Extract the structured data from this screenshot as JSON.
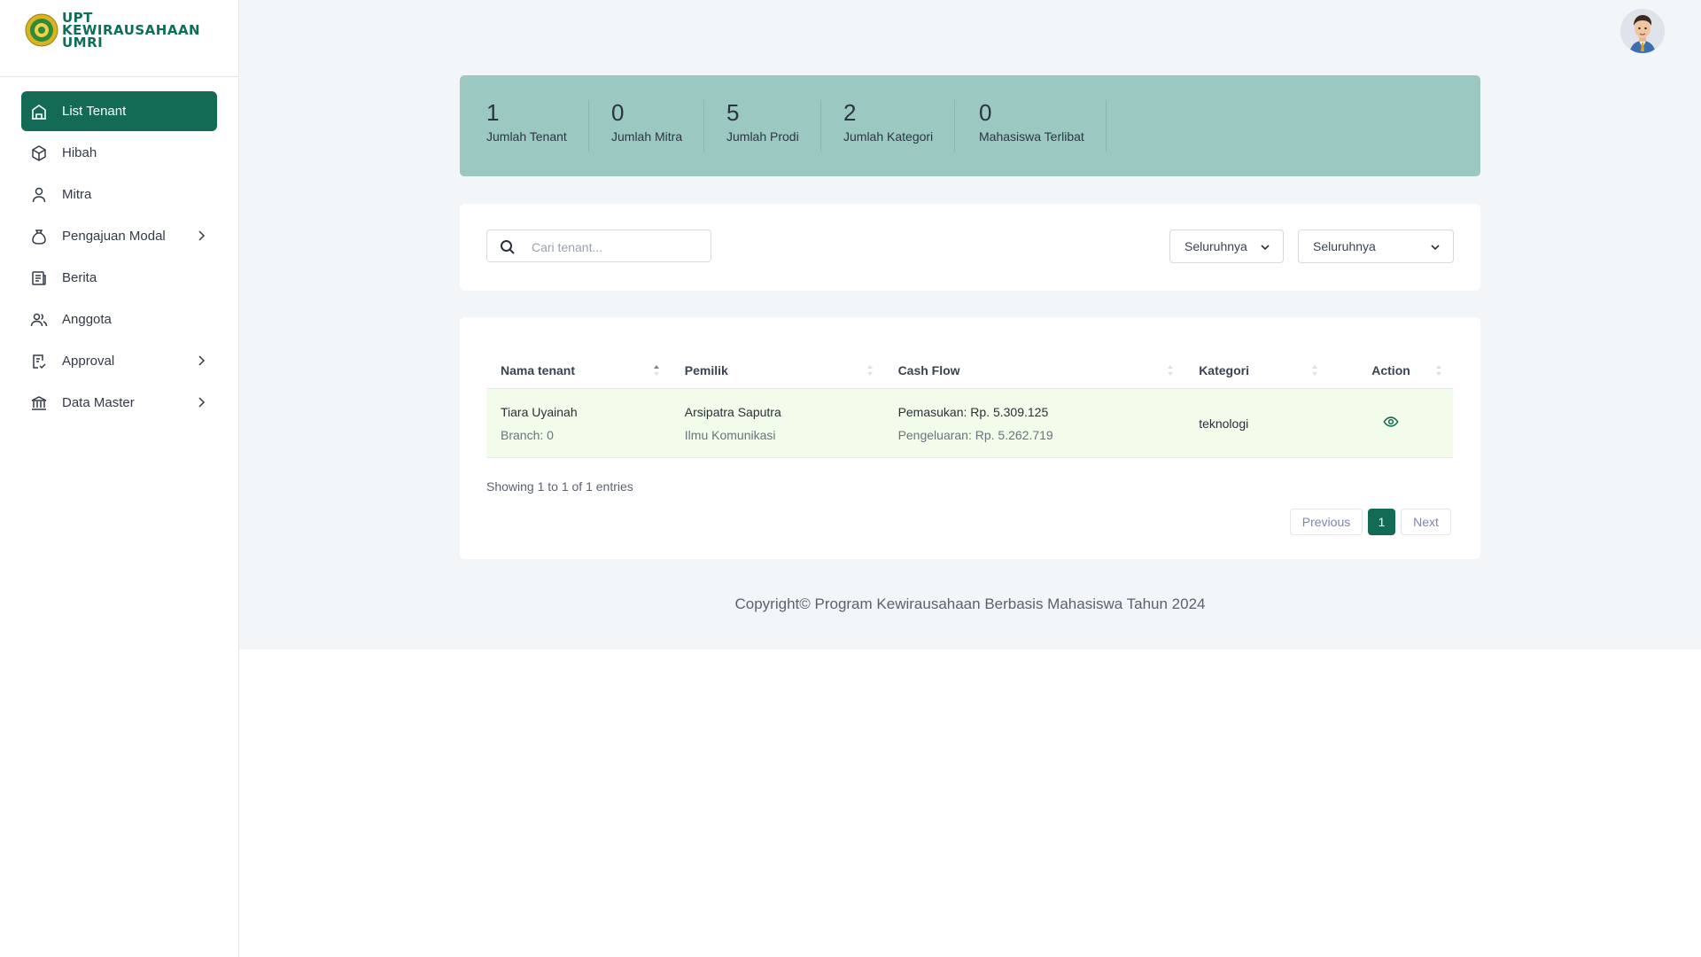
{
  "brand": {
    "lines": [
      "UPT",
      "KEWIRAUSAHAAN",
      "UMRI"
    ],
    "color": "#0f6e57"
  },
  "sidebar": {
    "items": [
      {
        "label": "List Tenant",
        "icon": "building-icon",
        "active": true
      },
      {
        "label": "Hibah",
        "icon": "box-icon"
      },
      {
        "label": "Mitra",
        "icon": "user-icon"
      },
      {
        "label": "Pengajuan Modal",
        "icon": "money-bag-icon",
        "submenu": true
      },
      {
        "label": "Berita",
        "icon": "newspaper-icon"
      },
      {
        "label": "Anggota",
        "icon": "users-icon"
      },
      {
        "label": "Approval",
        "icon": "document-check-icon",
        "submenu": true
      },
      {
        "label": "Data Master",
        "icon": "bank-icon",
        "submenu": true
      }
    ]
  },
  "stats": [
    {
      "value": "1",
      "label": "Jumlah Tenant"
    },
    {
      "value": "0",
      "label": "Jumlah Mitra"
    },
    {
      "value": "5",
      "label": "Jumlah Prodi"
    },
    {
      "value": "2",
      "label": "Jumlah Kategori"
    },
    {
      "value": "0",
      "label": "Mahasiswa Terlibat"
    }
  ],
  "filters": {
    "search_placeholder": "Cari tenant...",
    "select1": "Seluruhnya",
    "select2": "Seluruhnya"
  },
  "table": {
    "headers": [
      "Nama tenant",
      "Pemilik",
      "Cash Flow",
      "Kategori",
      "Action"
    ],
    "rows": [
      {
        "name": "Tiara Uyainah",
        "branch": "Branch: 0",
        "owner": "Arsipatra Saputra",
        "owner_prodi": "Ilmu Komunikasi",
        "income": "Pemasukan: Rp. 5.309.125",
        "expense": "Pengeluaran: Rp. 5.262.719",
        "category": "teknologi"
      }
    ],
    "info": "Showing 1 to 1 of 1 entries"
  },
  "pagination": {
    "previous": "Previous",
    "page": "1",
    "next": "Next"
  },
  "footer": "Copyright© Program Kewirausahaan Berbasis Mahasiswa Tahun 2024",
  "colors": {
    "accent": "#136b56",
    "stats_bg": "#9bc8c1",
    "row_highlight": "#f3fbea"
  }
}
